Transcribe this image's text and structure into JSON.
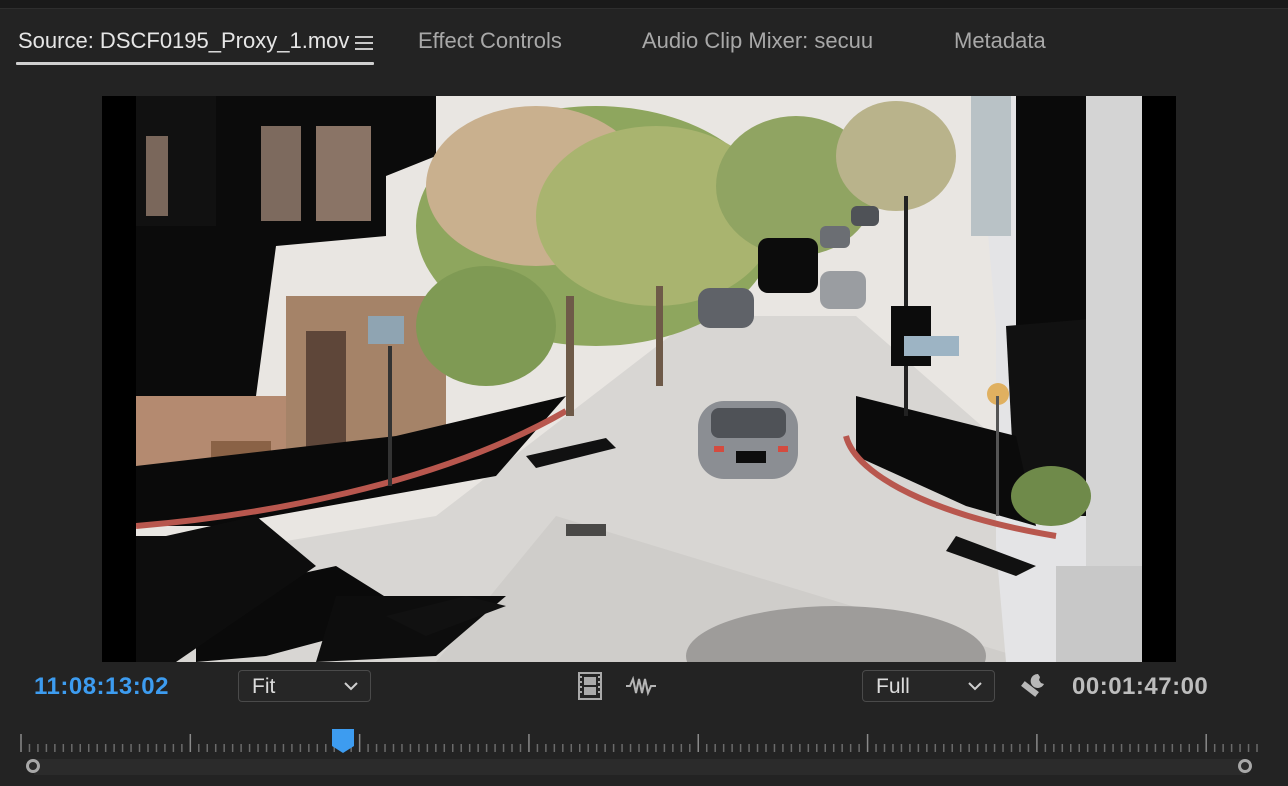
{
  "tabs": [
    {
      "label": "Source: DSCF0195_Proxy_1.mov",
      "active": true
    },
    {
      "label": "Effect Controls",
      "active": false
    },
    {
      "label": "Audio Clip Mixer: secuu",
      "active": false
    },
    {
      "label": "Metadata",
      "active": false
    }
  ],
  "transport": {
    "current_timecode": "11:08:13:02",
    "duration_timecode": "00:01:47:00",
    "zoom_dropdown": "Fit",
    "resolution_dropdown": "Full"
  },
  "timeline": {
    "playhead_fraction": 0.255
  },
  "colors": {
    "accent_blue": "#3d9cf0",
    "panel_bg": "#232323"
  },
  "icons": {
    "menu": "hamburger-menu-icon",
    "drag_video": "film-strip-icon",
    "drag_audio": "audio-waveform-icon",
    "settings": "wrench-icon"
  }
}
